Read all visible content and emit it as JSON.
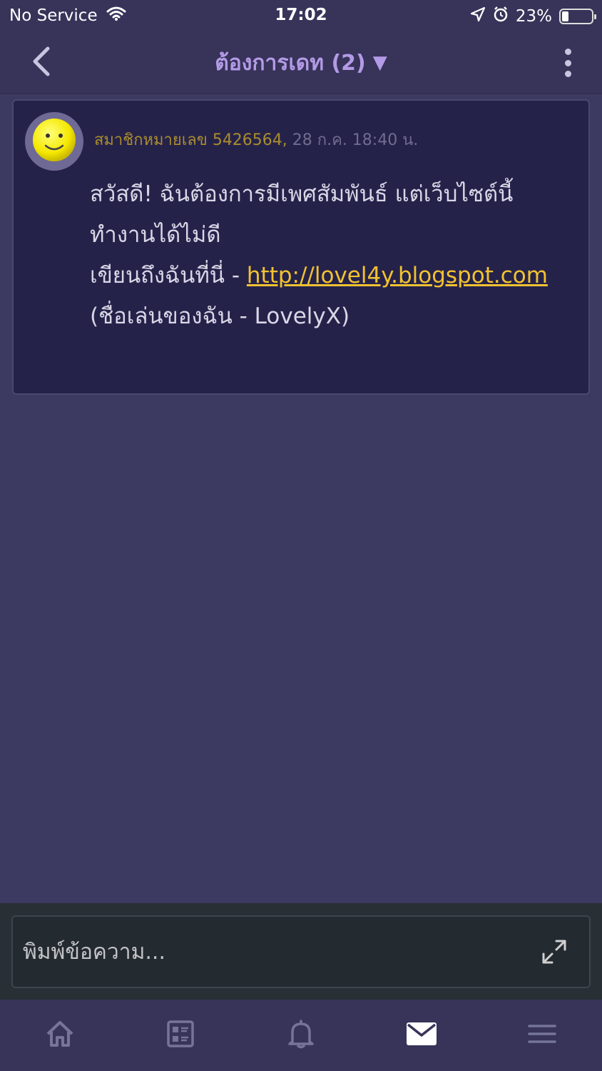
{
  "status_bar": {
    "carrier": "No Service",
    "time": "17:02",
    "battery": "23%",
    "battery_level": 0.23,
    "icons": [
      "wifi-icon",
      "location-arrow-icon",
      "alarm-icon",
      "battery-icon"
    ]
  },
  "header": {
    "title": "ต้องการเดท (2)",
    "title_caret": "▼",
    "back_icon": "chevron-left-icon",
    "more_icon": "more-vertical-icon"
  },
  "message": {
    "sender": "สมาชิกหมายเลข 5426564,",
    "time": "28 ก.ค. 18:40 น.",
    "text_line1": "สวัสดี! ฉันต้องการมีเพศสัมพันธ์ แต่เว็บไซต์นี้ทำงานได้ไม่ดี",
    "text_line2_prefix": "เขียนถึงฉันที่นี่ - ",
    "link": "http://lovel4y.blogspot.com",
    "text_suffix": " (ชื่อเล่นของฉัน - LovelyX)",
    "avatar_icon": "smiley-icon"
  },
  "composer": {
    "placeholder": "พิมพ์ข้อความ...",
    "value": "",
    "expand_icon": "expand-icon"
  },
  "bottom_nav": {
    "items": [
      {
        "icon": "home-icon",
        "active": false
      },
      {
        "icon": "forum-list-icon",
        "active": false
      },
      {
        "icon": "bell-icon",
        "active": false
      },
      {
        "icon": "envelope-icon",
        "active": true
      },
      {
        "icon": "menu-icon",
        "active": false
      }
    ]
  },
  "colors": {
    "background": "#3d3a62",
    "bar": "#373359",
    "card": "#25224a",
    "title": "#b39ae6",
    "link": "#f2c230",
    "sender": "#a98c2e"
  }
}
